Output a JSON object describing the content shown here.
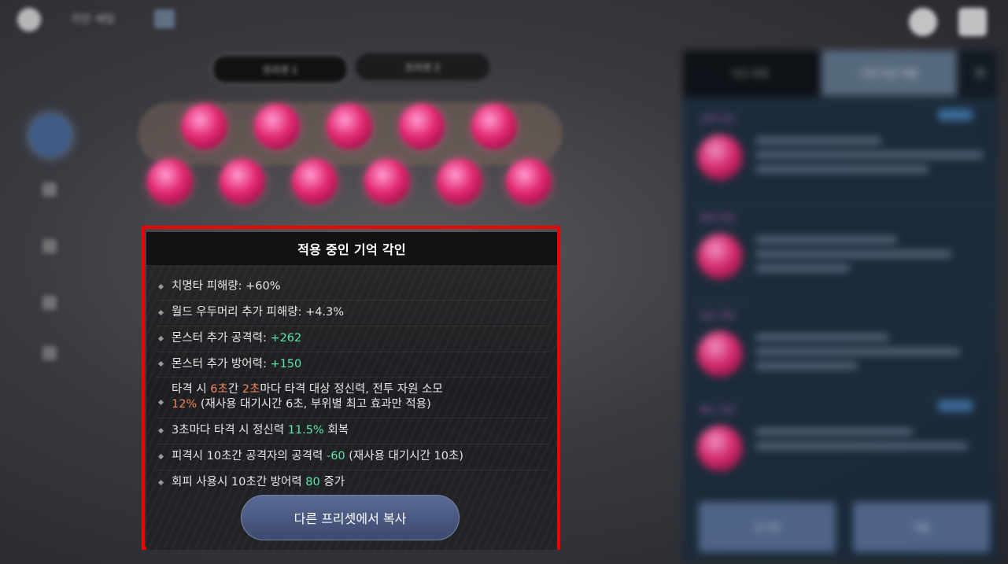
{
  "header": {
    "title": "각인 세팅"
  },
  "preset_tabs": [
    "프리셋 1",
    "프리셋 2"
  ],
  "right_panel": {
    "tabs": [
      "각인 목록",
      "기억 각인 적용"
    ],
    "card_titles": [
      "공격 각인",
      "방어 각인",
      "보조 각인",
      "특수 각인"
    ],
    "buttons": [
      "초기화",
      "적용"
    ]
  },
  "popup": {
    "title": "적용 중인 기억 각인",
    "effects": [
      {
        "label": "치명타 피해량: ",
        "value": "+60%"
      },
      {
        "label": "월드 우두머리 추가 피해량: ",
        "value": "+4.3%"
      },
      {
        "label": "몬스터 추가 공격력: ",
        "value": "+262"
      },
      {
        "label": "몬스터 추가 방어력: ",
        "value": "+150"
      },
      {
        "p1": "타격 시 ",
        "v1": "6초",
        "p2": "간 ",
        "v2": "2초",
        "p3": "마다 타격 대상 정신력, 전투 자원 소모",
        "v3": "12%",
        "p4": " (재사용 대기시간 6초, 부위별 최고 효과만 적용)"
      },
      {
        "p1": "3초마다 타격 시 정신력 ",
        "v1": "11.5%",
        "p2": " 회복"
      },
      {
        "p1": "피격시 10초간 공격자의 공격력 ",
        "v1": "-60",
        "p2": " (재사용 대기시간 10초)"
      },
      {
        "p1": "회피 사용시 10초간 방어력 ",
        "v1": "80",
        "p2": " 증가"
      }
    ],
    "copy_button": "다른 프리셋에서 복사"
  },
  "colors": {
    "highlight_frame": "#ee0000",
    "value_green": "#5de6a8",
    "value_orange": "#f5865a"
  }
}
